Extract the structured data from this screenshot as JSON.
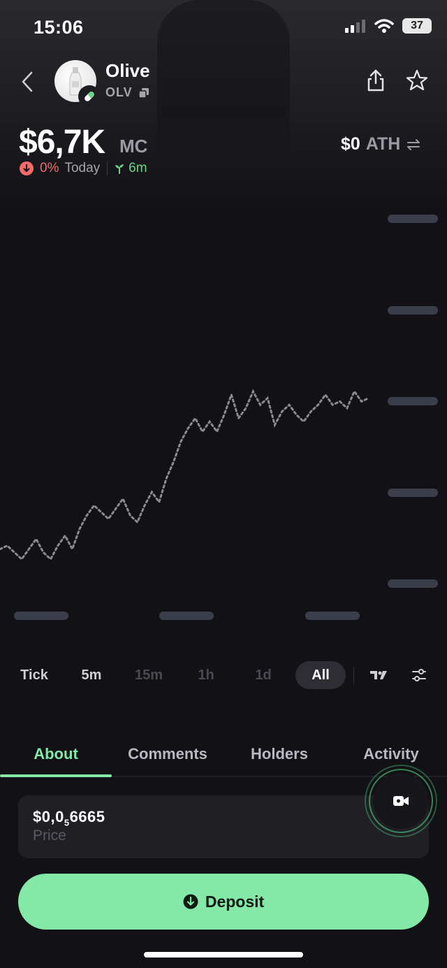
{
  "status_bar": {
    "time": "15:06",
    "battery": "37"
  },
  "token": {
    "name": "Olive",
    "symbol": "OLV",
    "market_cap": "$6,7K",
    "market_cap_label": "MC",
    "ath_value": "$0",
    "ath_label": "ATH",
    "change_pct": "0%",
    "change_period": "Today",
    "age": "6m"
  },
  "timeframes": [
    {
      "label": "Tick",
      "state": "enabled"
    },
    {
      "label": "5m",
      "state": "enabled"
    },
    {
      "label": "15m",
      "state": "disabled"
    },
    {
      "label": "1h",
      "state": "disabled"
    },
    {
      "label": "1d",
      "state": "disabled"
    },
    {
      "label": "All",
      "state": "selected"
    }
  ],
  "tabs": [
    {
      "label": "About",
      "active": true
    },
    {
      "label": "Comments",
      "active": false
    },
    {
      "label": "Holders",
      "active": false
    },
    {
      "label": "Activity",
      "active": false
    }
  ],
  "price": {
    "prefix": "$0,0",
    "subscript": "5",
    "digits": "6665",
    "label": "Price"
  },
  "deposit_label": "Deposit",
  "colors": {
    "accent": "#84e8a9",
    "negative": "#f26a6a",
    "positive": "#6bd48a",
    "background": "#121115"
  },
  "chart_data": {
    "type": "line",
    "style": "dotted",
    "x": [
      0,
      1,
      2,
      3,
      4,
      5,
      6,
      7,
      8,
      9,
      10,
      11,
      12,
      13,
      14,
      15,
      16,
      17,
      18,
      19,
      20,
      21,
      22,
      23,
      24,
      25,
      26,
      27,
      28,
      29,
      30,
      31,
      32,
      33,
      34,
      35,
      36,
      37,
      38,
      39,
      40,
      41,
      42,
      43,
      44,
      45,
      46,
      47,
      48,
      49,
      50,
      51
    ],
    "values": [
      16,
      17,
      15,
      13,
      16,
      19,
      15,
      13,
      17,
      20,
      16,
      22,
      26,
      29,
      27,
      25,
      28,
      31,
      26,
      24,
      29,
      33,
      30,
      37,
      42,
      48,
      52,
      55,
      51,
      54,
      51,
      56,
      62,
      55,
      58,
      63,
      59,
      61,
      53,
      57,
      59,
      56,
      54,
      57,
      59,
      62,
      59,
      60,
      58,
      63,
      60,
      61
    ],
    "y_axis_labels_loading": true,
    "x_axis_labels_loading": true,
    "grid": false
  }
}
